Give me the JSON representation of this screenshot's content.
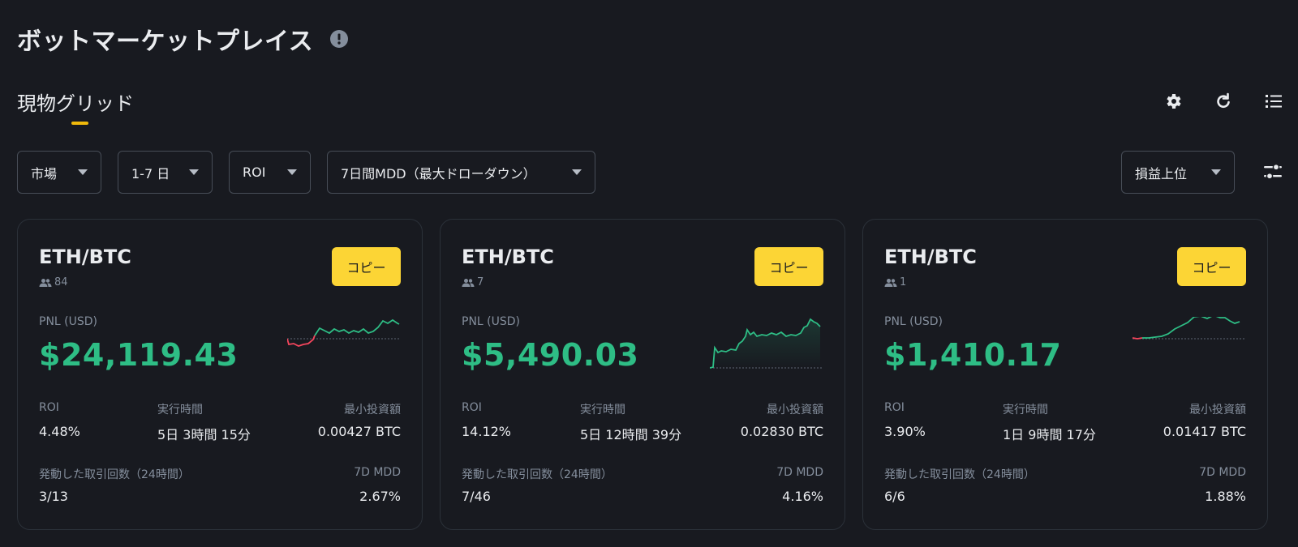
{
  "page": {
    "title": "ボットマーケットプレイス",
    "tab": "現物グリッド"
  },
  "colors": {
    "background": "#181a20",
    "accent": "#fcd535",
    "positive": "#2ebd85",
    "negative": "#f6465d",
    "muted": "#848e9c"
  },
  "toolbar": {
    "icons": [
      "gear-icon",
      "refresh-icon",
      "list-icon"
    ]
  },
  "filters": {
    "market": "市場",
    "period": "1-7 日",
    "roi": "ROI",
    "mdd": "7日間MDD（最大ドローダウン）",
    "sort": "損益上位"
  },
  "labels": {
    "pnl": "PNL (USD)",
    "roi": "ROI",
    "runtime": "実行時間",
    "min_investment": "最小投資額",
    "trades": "発動した取引回数（24時間）",
    "mdd": "7D MDD",
    "copy": "コピー"
  },
  "cards": [
    {
      "pair": "ETH/BTC",
      "users": "84",
      "pnl": "$24,119.43",
      "roi": "4.48%",
      "runtime": "5日 3時間 15分",
      "min_investment": "0.00427 BTC",
      "trades": "3/13",
      "mdd": "2.67%"
    },
    {
      "pair": "ETH/BTC",
      "users": "7",
      "pnl": "$5,490.03",
      "roi": "14.12%",
      "runtime": "5日 12時間 39分",
      "min_investment": "0.02830 BTC",
      "trades": "7/46",
      "mdd": "4.16%"
    },
    {
      "pair": "ETH/BTC",
      "users": "1",
      "pnl": "$1,410.17",
      "roi": "3.90%",
      "runtime": "1日 9時間 17分",
      "min_investment": "0.01417 BTC",
      "trades": "6/6",
      "mdd": "1.88%"
    }
  ]
}
